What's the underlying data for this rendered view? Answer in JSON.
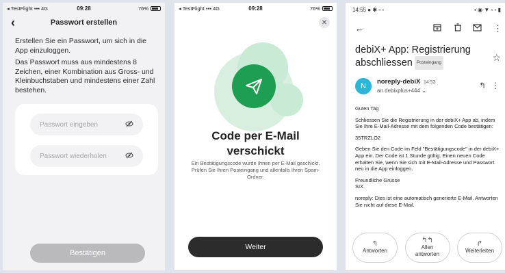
{
  "screen1": {
    "status": {
      "carrier": "◂ TestFlight",
      "network": "4G",
      "time": "09:28",
      "battery": "76%"
    },
    "title": "Passwort erstellen",
    "intro1": "Erstellen Sie ein Passwort, um sich in die App einzuloggen.",
    "intro2": "Das Passwort muss aus mindestens 8 Zeichen, einer Kombination aus Gross- und Kleinbuchstaben und mindestens einer Zahl bestehen.",
    "password_placeholder": "Passwort eingeben",
    "repeat_placeholder": "Passwort wiederholen",
    "confirm_label": "Bestätigen"
  },
  "screen2": {
    "status": {
      "carrier": "◂ TestFlight",
      "network": "4G",
      "time": "09:28",
      "battery": "76%"
    },
    "title_line1": "Code per E-Mail",
    "title_line2": "verschickt",
    "description": "Ein Bestätigungscode wurde Ihnen per E-Mail geschickt. Prüfen Sie Ihren Posteingang und allenfalls Ihren Spam-Ordner.",
    "next_label": "Weiter"
  },
  "screen3": {
    "status_time": "14:55",
    "subject_line1": "debiX+ App: Registrierung",
    "subject_line2": "abschliessen",
    "label": "Posteingang",
    "avatar_letter": "N",
    "sender": "noreply-debiX",
    "sent_time": "14:53",
    "recipient": "an debixplus+444",
    "greeting": "Guten Tag",
    "para1": "Schliessen Sie die Registrierung in der debiX+ App ab, indem Sie Ihre E-Mail-Adresse mit dem folgenden Code bestätigen:",
    "code": "35TRZLO2",
    "para2": "Geben Sie den Code im Feld \"Bestätigungscode\" in der debiX+ App ein. Der Code ist 1 Stunde gültig. Einen neuen Code erhalten Sie, wenn Sie sich mit E-Mail-Adresse und Passwort neu in die App einloggen.",
    "signoff1": "Freundliche Grüsse",
    "signoff2": "SIX",
    "footer": "noreply: Dies ist eine automatisch generierte E-Mail. Antworten Sie nicht auf diese E-Mail.",
    "actions": {
      "reply": "Antworten",
      "reply_all_1": "Allen",
      "reply_all_2": "antworten",
      "forward": "Weiterleiten"
    }
  },
  "colors": {
    "accent_green": "#1e9e52",
    "dark_button": "#2c2c2c",
    "disabled_button": "#b9b9be",
    "avatar": "#2ab6d6"
  }
}
